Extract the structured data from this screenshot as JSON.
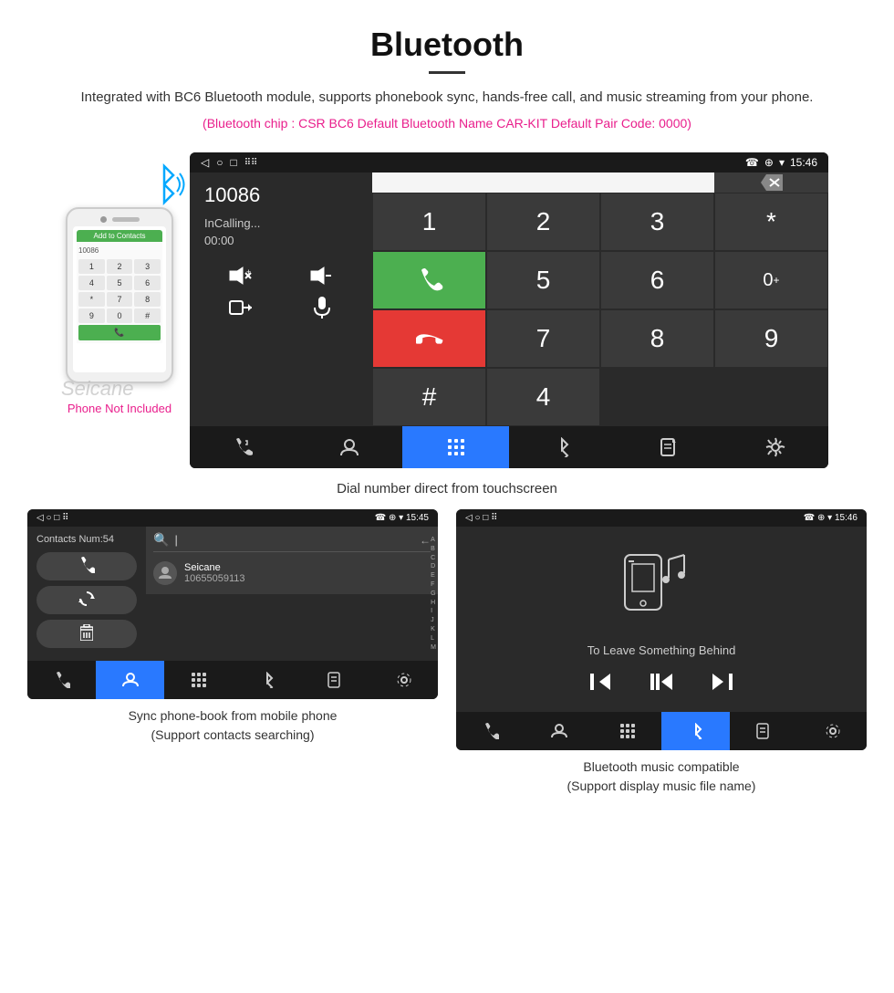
{
  "header": {
    "title": "Bluetooth",
    "description": "Integrated with BC6 Bluetooth module, supports phonebook sync, hands-free call, and music streaming from your phone.",
    "specs": "(Bluetooth chip : CSR BC6    Default Bluetooth Name CAR-KIT    Default Pair Code: 0000)"
  },
  "phone_mockup": {
    "add_to_contacts": "Add to Contacts",
    "not_included": "Phone Not Included"
  },
  "car_screen": {
    "status_bar": {
      "left_icons": "◁  ○  □  ⠿",
      "right_icons": "☎  ⊕  ▾",
      "time": "15:46"
    },
    "number": "10086",
    "calling_status": "InCalling...",
    "timer": "00:00",
    "dialpad": [
      "1",
      "2",
      "3",
      "*",
      "4",
      "5",
      "6",
      "0+",
      "7",
      "8",
      "9",
      "#"
    ],
    "delete_icon": "⌫"
  },
  "main_caption": "Dial number direct from touchscreen",
  "contacts_screen": {
    "status_time": "15:45",
    "contacts_count": "Contacts Num:54",
    "buttons": [
      "☎",
      "↺",
      "🗑"
    ],
    "search_placeholder": "|",
    "contact_name": "Seicane",
    "contact_number": "10655059113",
    "alphabet": "A\nB\nC\nD\nE\nF\nG\nH\nI\nJ\nK\nL\nM"
  },
  "contacts_caption": {
    "line1": "Sync phone-book from mobile phone",
    "line2": "(Support contacts searching)"
  },
  "music_screen": {
    "status_time": "15:46",
    "song_title": "To Leave Something Behind"
  },
  "music_caption": {
    "line1": "Bluetooth music compatible",
    "line2": "(Support display music file name)"
  },
  "seicane_watermark": "Seicane"
}
